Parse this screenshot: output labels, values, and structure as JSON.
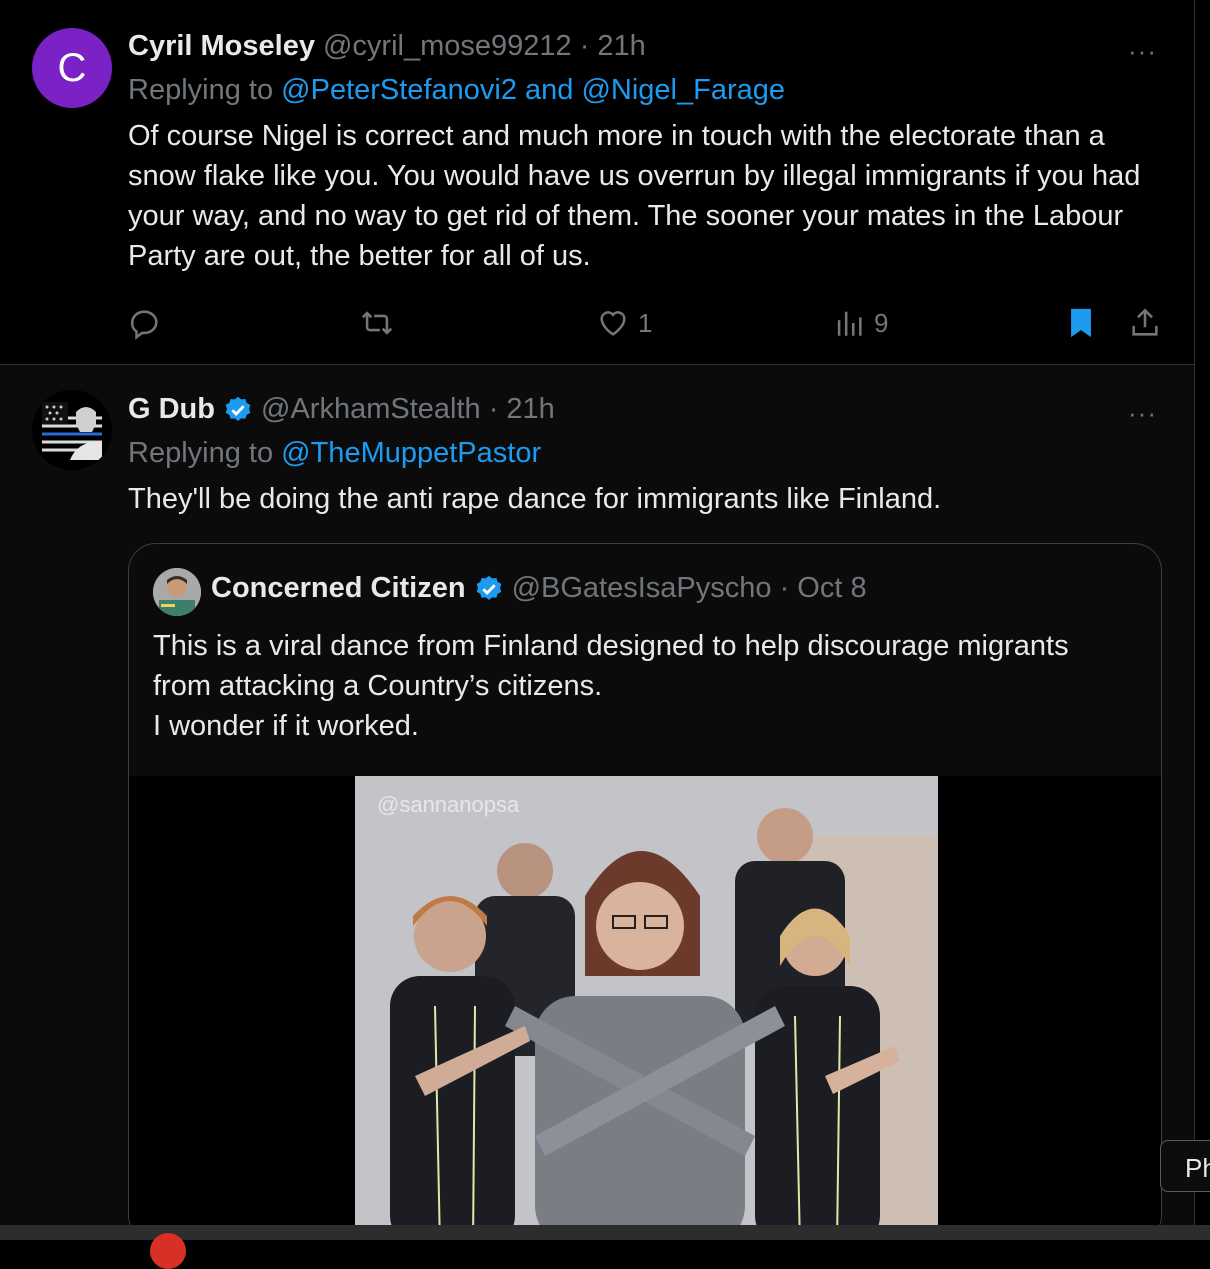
{
  "tweets": [
    {
      "avatar_letter": "C",
      "avatar_color": "#7b22c6",
      "name": "Cyril Moseley",
      "meta": "@cyril_mose99212 · 21h",
      "replying_label": "Replying to",
      "replying_to": "@PeterStefanovi2 and @Nigel_Farage",
      "text": "Of course Nigel is correct and much more in touch with the electorate than a snow flake like you. You would have us overrun by illegal immigrants if you had your way, and no way to get rid of them. The sooner your mates in the Labour Party are out, the better for all of us.",
      "more_label": "···",
      "likes": "1",
      "views": "9"
    },
    {
      "name": "G Dub",
      "verified": true,
      "meta": "@ArkhamStealth · 21h",
      "replying_label": "Replying to",
      "replying_to": "@TheMuppetPastor",
      "text": "They'll be doing the anti rape dance for immigrants like Finland.",
      "more_label": "···",
      "quote": {
        "name": "Concerned Citizen",
        "verified": true,
        "meta": "@BGatesIsaPyscho · Oct 8",
        "text_lines": [
          "This is a viral dance from Finland designed to help discourage migrants",
          "from attacking a Country’s citizens.",
          "I wonder if it worked."
        ],
        "video_watermark": "@sannanopsa"
      }
    }
  ],
  "tooltip_text": "Ph",
  "colors": {
    "link": "#1d9bf0",
    "bookmark_active": "#1d9bf0",
    "muted": "#71767b",
    "verified": "#1d9bf0"
  },
  "icons": [
    "reply-icon",
    "retweet-icon",
    "like-icon",
    "views-icon",
    "bookmark-icon",
    "share-icon",
    "verified-icon",
    "more-icon"
  ]
}
